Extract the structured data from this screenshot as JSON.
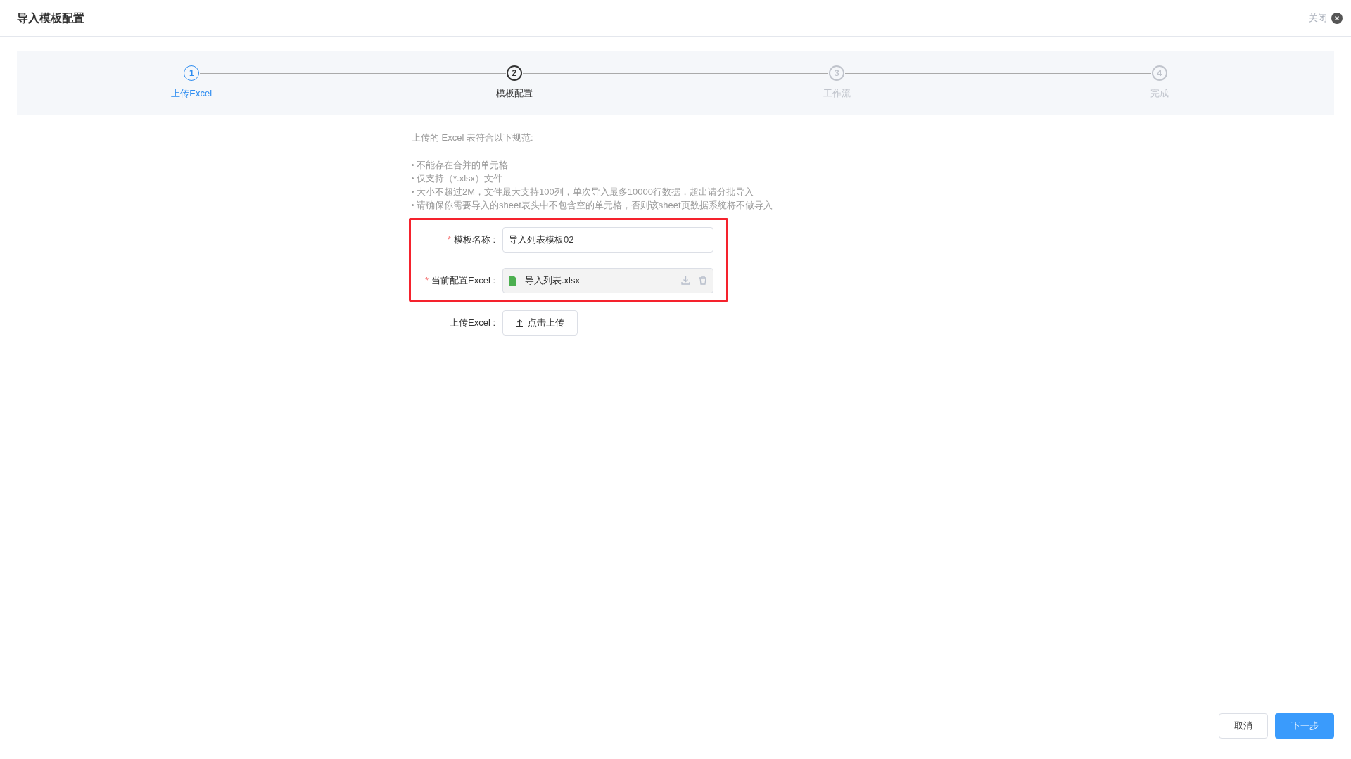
{
  "window": {
    "title": "导入模板配置",
    "close_label": "关闭"
  },
  "steps": [
    {
      "number": "1",
      "label": "上传Excel",
      "finished": true,
      "active": false
    },
    {
      "number": "2",
      "label": "模板配置",
      "finished": false,
      "active": true
    },
    {
      "number": "3",
      "label": "工作流",
      "finished": false,
      "active": false
    },
    {
      "number": "4",
      "label": "完成",
      "finished": false,
      "active": false
    }
  ],
  "rules": {
    "intro": "上传的 Excel 表符合以下规范:",
    "items": [
      "不能存在合并的单元格",
      "仅支持（*.xlsx）文件",
      "大小不超过2M，文件最大支持100列，单次导入最多10000行数据，超出请分批导入",
      "请确保你需要导入的sheet表头中不包含空的单元格，否则该sheet页数据系统将不做导入"
    ]
  },
  "form": {
    "highlighted": true,
    "fields": [
      {
        "kind": "input",
        "required_mark": "*",
        "label": "模板名称 :",
        "value": "导入列表模板02"
      },
      {
        "kind": "file",
        "required_mark": "*",
        "label": "当前配置Excel :",
        "value": "导入列表.xlsx"
      },
      {
        "kind": "upload",
        "label": "上传Excel :",
        "button": "点击上传"
      }
    ]
  },
  "footer": {
    "buttons": [
      {
        "label": "取消",
        "primary": false
      },
      {
        "label": "下一步",
        "primary": true
      }
    ]
  }
}
